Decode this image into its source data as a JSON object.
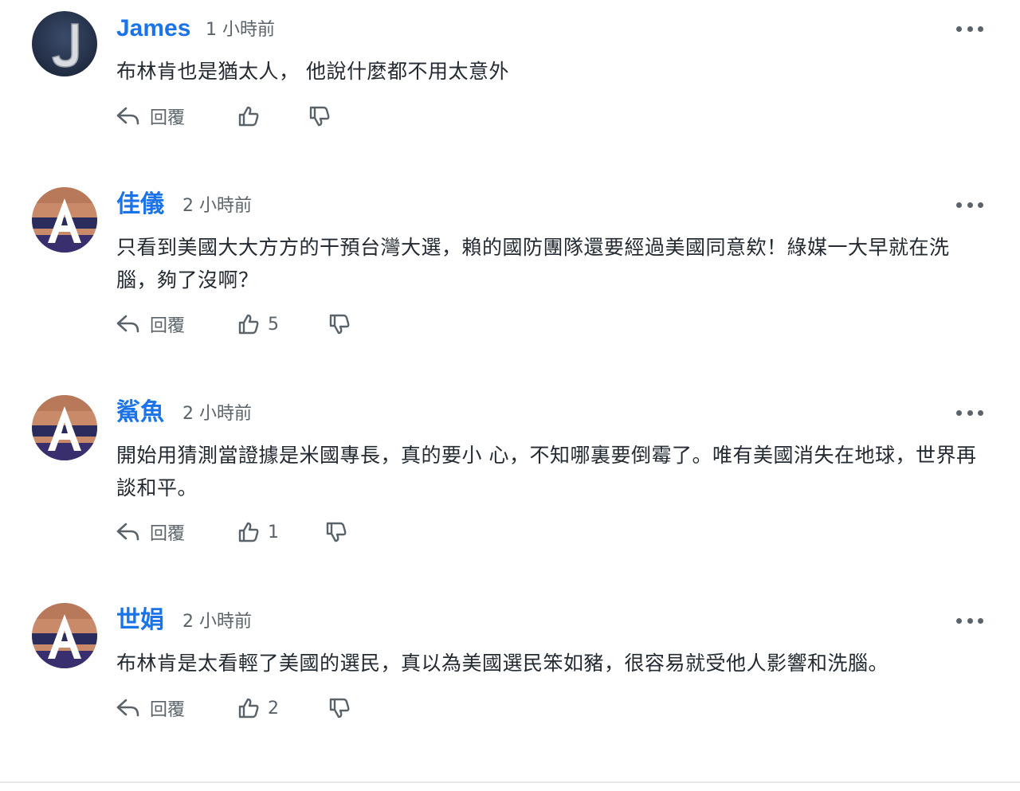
{
  "comments": [
    {
      "author": "James",
      "time": "1 小時前",
      "text": "布林肯也是猶太人， 他說什麼都不用太意外",
      "reply_label": "回覆",
      "likes": "",
      "avatar": "j-icon-avatar"
    },
    {
      "author": "佳儀",
      "time": "2 小時前",
      "text": "只看到美國大大方方的干預台灣大選，賴的國防團隊還要經過美國同意欸！綠媒一大早就在洗腦，夠了沒啊？",
      "reply_label": "回覆",
      "likes": "5",
      "avatar": "a-icon-avatar"
    },
    {
      "author": "鯊魚",
      "time": "2 小時前",
      "text": "開始用猜測當證據是米國專長，真的要小 心，不知哪裏要倒霉了。唯有美國消失在地球，世界再談和平。",
      "reply_label": "回覆",
      "likes": "1",
      "avatar": "a-icon-avatar"
    },
    {
      "author": "世娟",
      "time": "2 小時前",
      "text": "布林肯是太看輕了美國的選民，真以為美國選民笨如豬，很容易就受他人影響和洗腦。",
      "reply_label": "回覆",
      "likes": "2",
      "avatar": "a-icon-avatar"
    }
  ],
  "colors": {
    "author": "#1a73e8",
    "meta": "#5b636a",
    "text": "#232a31"
  }
}
